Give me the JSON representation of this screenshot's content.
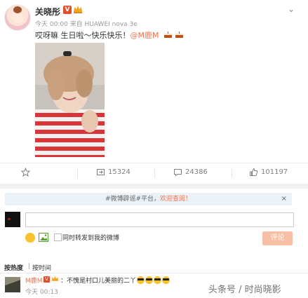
{
  "post": {
    "author": "关晓彤",
    "verified_badge": "V",
    "timestamp_source": "今天 00:00 来自 HUAWEI nova 3e",
    "content_text": "哎呀嘛 生日啦～快乐快乐！",
    "mention": "@M鹿M",
    "icons": [
      "chevron-down-icon",
      "cake-icon",
      "crown-icon"
    ]
  },
  "actions": {
    "favorite": "",
    "repost": "15324",
    "comment": "24386",
    "like": "101197"
  },
  "notice": {
    "prefix": "#微博辟谣#平台，",
    "link": "欢迎查阅！",
    "close": "×"
  },
  "composer": {
    "repost_label": "同时转发到我的微博",
    "submit": "评论"
  },
  "sort": {
    "hot": "按热度",
    "separator": "|",
    "time": "按时间"
  },
  "comment": {
    "user": "M鹿M",
    "badge": "V",
    "text": "：不愧是村口儿美丽的二丫",
    "time": "今天 00:13"
  },
  "watermark": "头条号 / 时尚晓影",
  "colors": {
    "accent": "#eb7350",
    "notice_bg": "#eaf1f7",
    "badge": "#e0502a"
  }
}
